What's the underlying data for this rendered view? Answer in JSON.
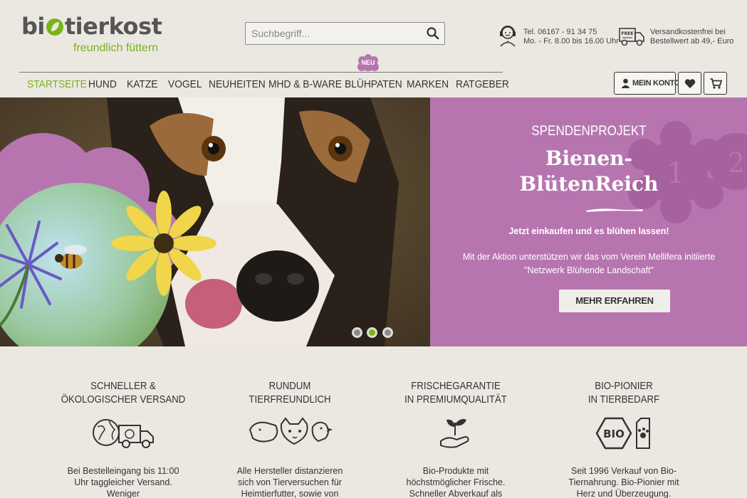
{
  "header": {
    "logo": {
      "main_left": "bi",
      "main_right": "tierkost",
      "tagline": "freundlich füttern"
    },
    "search": {
      "placeholder": "Suchbegriff..."
    },
    "contact": {
      "line1": "Tel. 06167 - 91 34 75",
      "line2": "Mo. - Fr. 8.00 bis 16.00 Uhr"
    },
    "shipping": {
      "line1": "Versandkostenfrei bei",
      "line2": "Bestellwert ab 49,- Euro",
      "badge": "FREE"
    },
    "account_label": "MEIN KONTO"
  },
  "nav": {
    "items": [
      {
        "label": "STARTSEITE"
      },
      {
        "label": "HUND"
      },
      {
        "label": "KATZE"
      },
      {
        "label": "VOGEL"
      },
      {
        "label": "NEUHEITEN"
      },
      {
        "label": "MHD & B-WARE"
      },
      {
        "label": "BLÜHPATEN"
      },
      {
        "label": "MARKEN"
      },
      {
        "label": "RATGEBER"
      }
    ],
    "badge": "NEU"
  },
  "hero": {
    "kicker": "SPENDENPROJEKT",
    "title_line1": "Bienen-",
    "title_line2": "BlütenReich",
    "lead": "Jetzt einkaufen und es blühen lassen!",
    "text_line1": "Mit der Aktion unterstützen wir das vom Verein Mellifera initiierte",
    "text_line2": "\"Netzwerk Blühende Landschaft\"",
    "button": "MEHR ERFAHREN",
    "deco_numbers": [
      "1",
      "2"
    ]
  },
  "features": [
    {
      "title_line1": "SCHNELLER &",
      "title_line2": "ÖKOLOGISCHER VERSAND",
      "text": "Bei Bestelleingang bis 11:00 Uhr taggleicher Versand. Weniger"
    },
    {
      "title_line1": "RUNDUM",
      "title_line2": "TIERFREUNDLICH",
      "text": "Alle Hersteller distanzieren sich von Tierversuchen für Heimtierfutter, sowie von"
    },
    {
      "title_line1": "FRISCHEGARANTIE",
      "title_line2": "IN PREMIUMQUALITÄT",
      "text": "Bio-Produkte mit höchstmöglicher Frische. Schneller Abverkauf als"
    },
    {
      "title_line1": "BIO-PIONIER",
      "title_line2": "IN TIERBEDARF",
      "text": "Seit 1996 Verkauf von Bio-Tiernahrung. Bio-Pionier mit Herz und Überzeugung.",
      "seal_text": "BIO"
    }
  ],
  "colors": {
    "accent": "#7ab317",
    "panel": "#b775b0",
    "background": "#ebe8e2"
  }
}
